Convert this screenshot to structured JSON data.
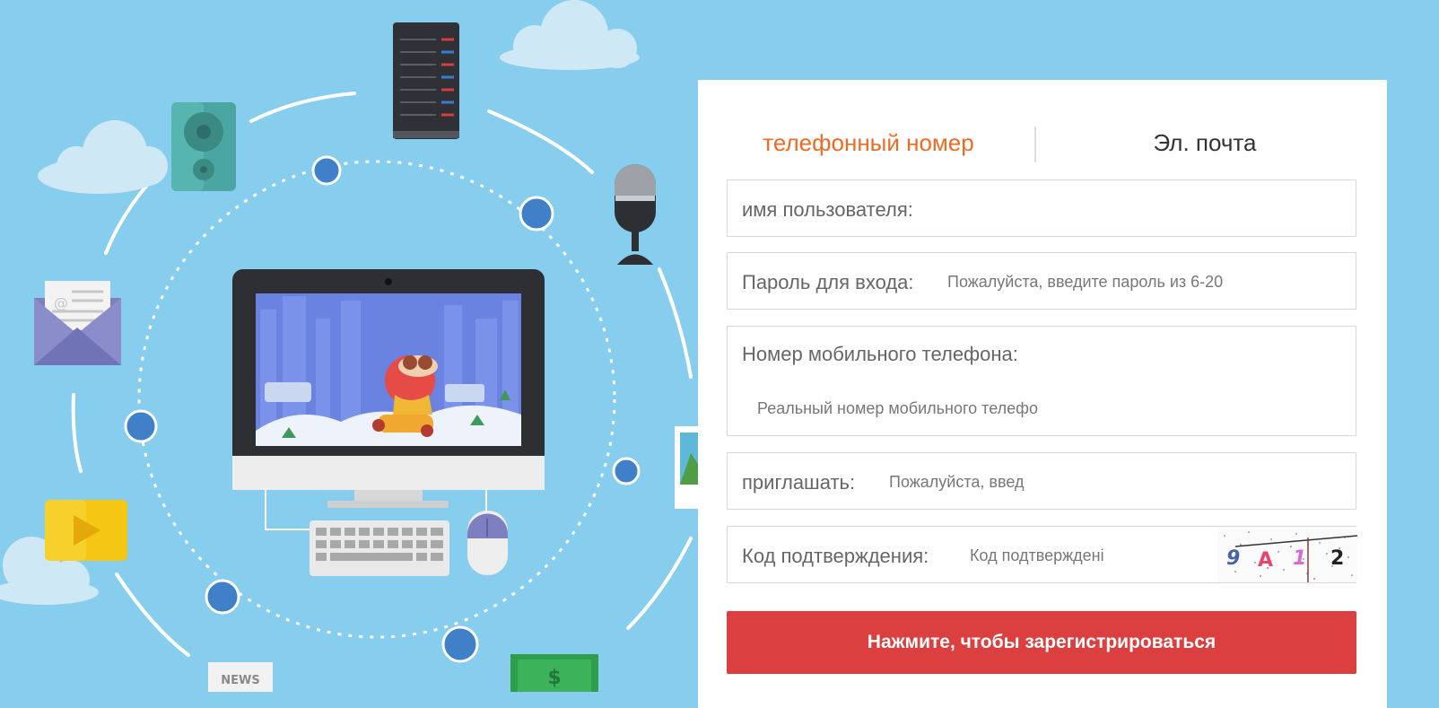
{
  "colors": {
    "background": "#87cdee",
    "accent": "#f06a22",
    "submit": "#dc3f3f",
    "tab_inactive": "#333333"
  },
  "illustration": {
    "news_label": "NEWS",
    "money_label": "$"
  },
  "tabs": {
    "phone": "телефонный номер",
    "email": "Эл. почта",
    "active": "phone"
  },
  "form": {
    "username": {
      "label": "имя пользователя:",
      "placeholder": ""
    },
    "password": {
      "label": "Пароль для входа:",
      "placeholder": "Пожалуйста, введите пароль из 6-20"
    },
    "mobile": {
      "label": "Номер мобильного телефона:",
      "placeholder": "Реальный номер мобильного телефо"
    },
    "invite": {
      "label": "приглашать:",
      "placeholder": "Пожалуйста, введ"
    },
    "captcha": {
      "label": "Код подтверждения:",
      "placeholder": "Код подтверждені",
      "code_chars": [
        "9",
        "A",
        "1",
        "2"
      ]
    },
    "submit_label": "Нажмите, чтобы зарегистрироваться"
  }
}
